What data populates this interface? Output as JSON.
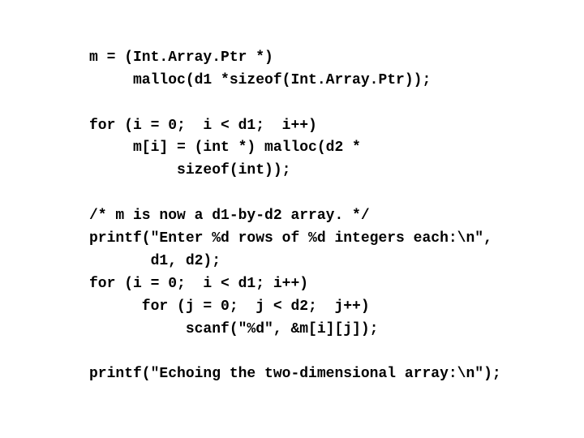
{
  "code": {
    "lines": [
      "m = (Int.Array.Ptr *)",
      "     malloc(d1 *sizeof(Int.Array.Ptr));",
      "",
      "for (i = 0;  i < d1;  i++)",
      "     m[i] = (int *) malloc(d2 *",
      "          sizeof(int));",
      "",
      "/* m is now a d1-by-d2 array. */",
      "printf(\"Enter %d rows of %d integers each:\\n\",",
      "       d1, d2);",
      "for (i = 0;  i < d1; i++)",
      "      for (j = 0;  j < d2;  j++)",
      "           scanf(\"%d\", &m[i][j]);",
      "",
      "printf(\"Echoing the two-dimensional array:\\n\");"
    ]
  }
}
